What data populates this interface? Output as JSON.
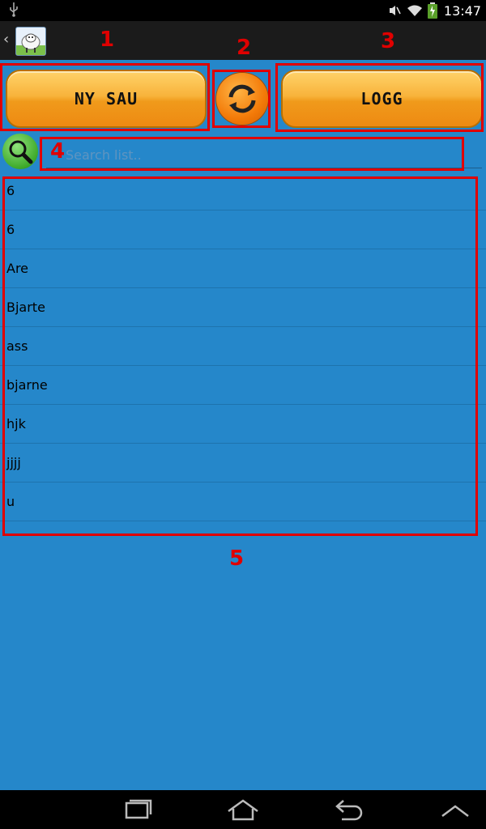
{
  "status_bar": {
    "time": "13:47",
    "icons": [
      "usb-icon",
      "mute-icon",
      "wifi-icon",
      "battery-icon"
    ]
  },
  "action_bar": {
    "back_symbol": "‹",
    "app_icon": "sheep-app-icon"
  },
  "buttons": {
    "new_sheep": "NY SAU",
    "log": "LOGG",
    "refresh_icon": "refresh-icon"
  },
  "search": {
    "placeholder": "Search list..",
    "icon": "search-icon"
  },
  "list": {
    "items": [
      "6",
      "6",
      "Are",
      "Bjarte",
      "ass",
      "bjarne",
      "hjk",
      "jjjj",
      "u"
    ]
  },
  "annotations": {
    "labels": [
      "1",
      "2",
      "3",
      "4",
      "5"
    ],
    "color": "#e00000"
  },
  "colors": {
    "background": "#2587ca",
    "button": "#f8b33b",
    "action_bar": "#1b1b1b"
  },
  "navbar": {
    "icons": [
      "recent-apps-icon",
      "home-icon",
      "back-icon",
      "up-icon"
    ]
  }
}
